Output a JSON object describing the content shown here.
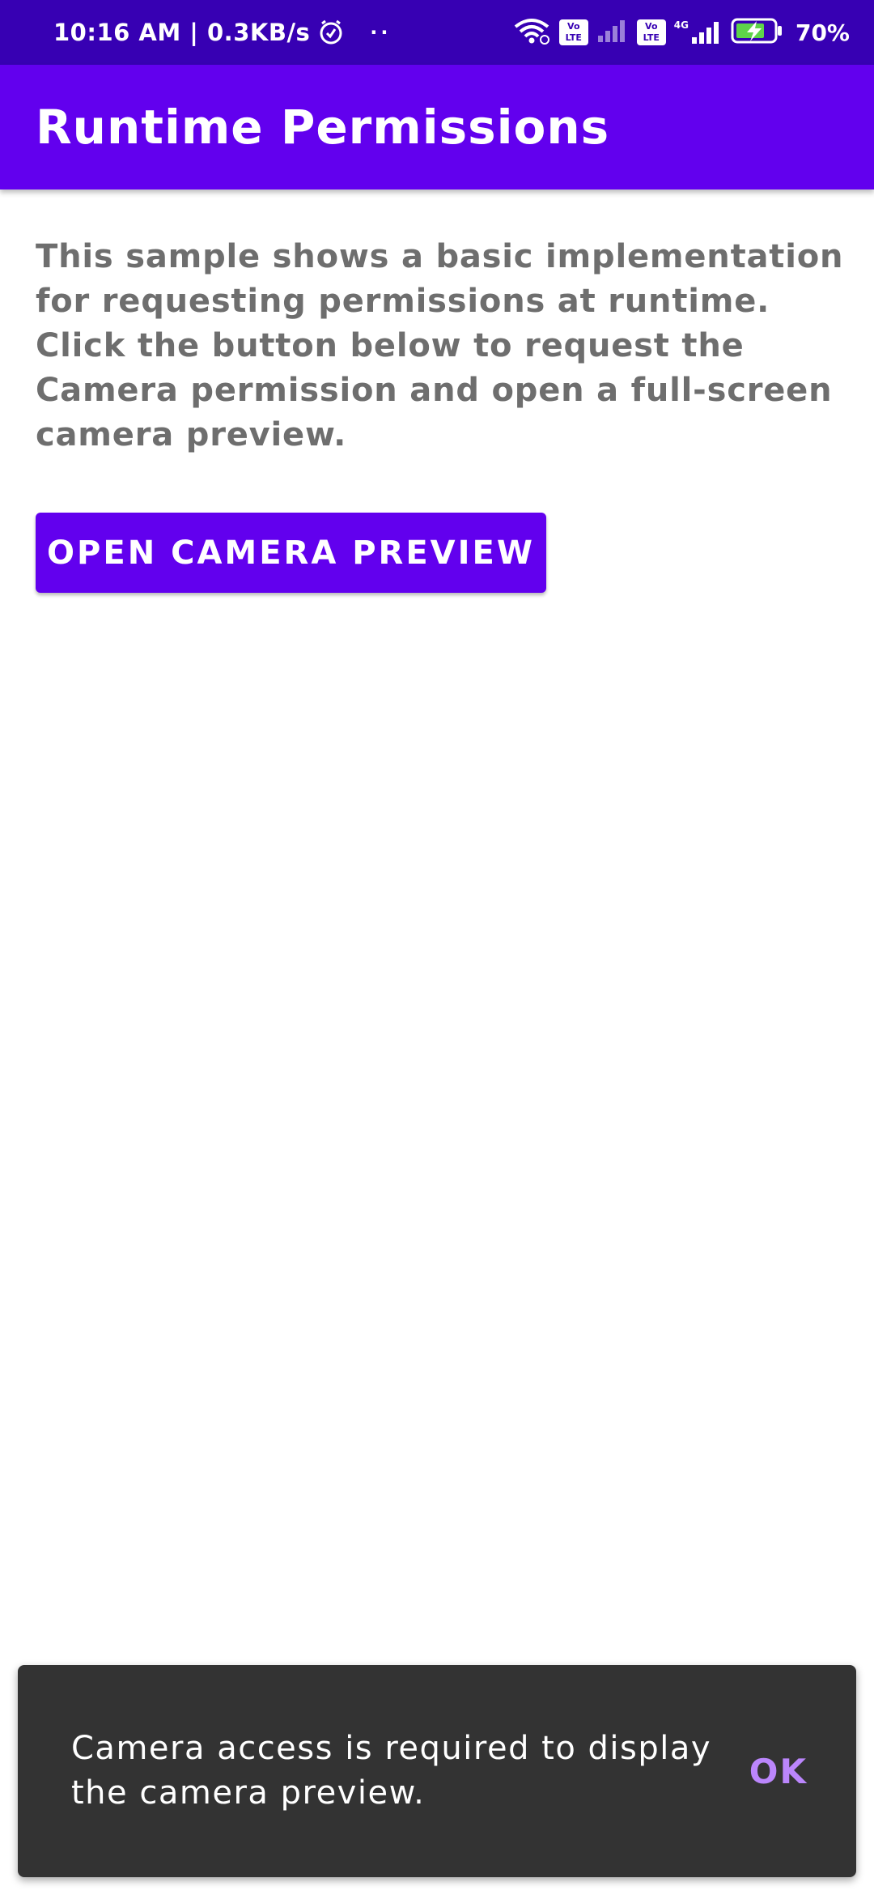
{
  "status_bar": {
    "time_speed": "10:16 AM | 0.3KB/s",
    "dots": "··",
    "volte_1": "Vo LTE",
    "volte_2": "Vo LTE",
    "network_type": "4G",
    "battery_percent": "70%",
    "icons": [
      "alarm-icon",
      "wifi-icon",
      "signal-icon",
      "battery-charging-icon"
    ]
  },
  "app_bar": {
    "title": "Runtime Permissions"
  },
  "main": {
    "description_lines": [
      "This sample shows a basic implementation for requesting permissions at runtime.",
      "Click the button below to request the Camera permission and open a full-screen camera preview."
    ],
    "button_label": "OPEN CAMERA PREVIEW"
  },
  "snackbar": {
    "message": "Camera access is required to display the camera preview.",
    "action_label": "OK"
  },
  "colors": {
    "status_bar": "#3700b3",
    "primary": "#6200ee",
    "snackbar_bg": "#333333",
    "snackbar_action": "#bb86fc",
    "body_text": "#6e6e6e"
  }
}
